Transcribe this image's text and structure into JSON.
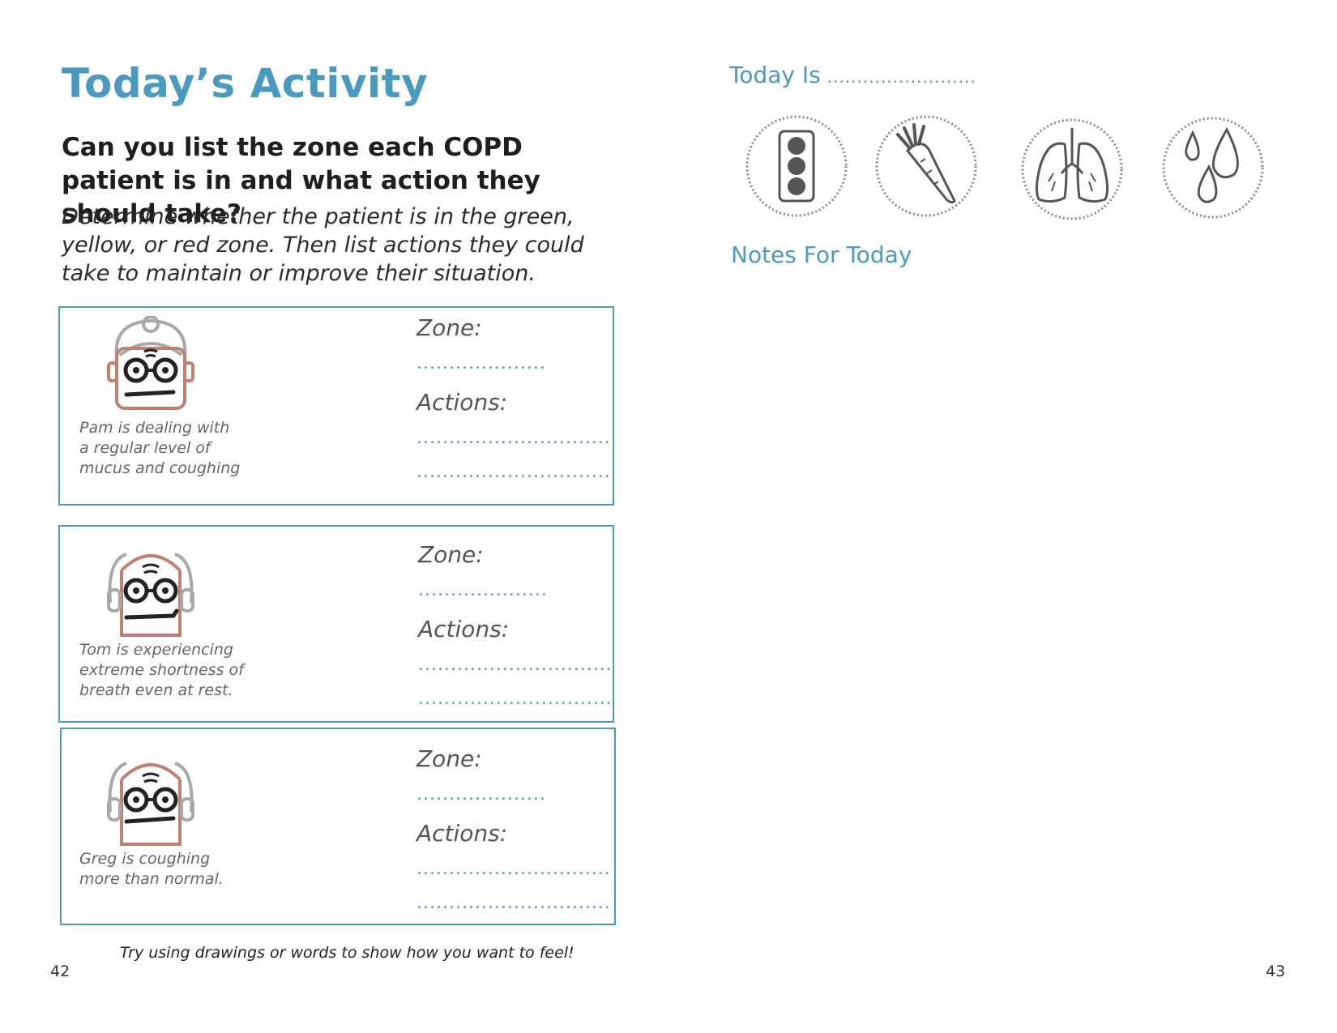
{
  "left_page": {
    "title": "Today’s Activity",
    "question": "Can you list the zone each COPD patient is in and what action they should take?",
    "instructions": "Determine whether the patient is in the green, yellow, or red zone. Then list actions they could take to maintain or improve their situation.",
    "cards": [
      {
        "description_lines": [
          "Pam is dealing with",
          "a regular level of",
          "mucus and coughing"
        ],
        "zone_label": "Zone:",
        "zone_blank": "....................",
        "actions_label": "Actions:",
        "action_blanks": [
          "..............................",
          ".............................."
        ]
      },
      {
        "description_lines": [
          "Tom is experiencing",
          "extreme shortness of",
          "breath even at rest."
        ],
        "zone_label": "Zone:",
        "zone_blank": "....................",
        "actions_label": "Actions:",
        "action_blanks": [
          "..............................",
          ".............................."
        ]
      },
      {
        "description_lines": [
          "Greg is coughing",
          "more than normal."
        ],
        "zone_label": "Zone:",
        "zone_blank": "....................",
        "actions_label": "Actions:",
        "action_blanks": [
          "..............................",
          ".............................."
        ]
      }
    ],
    "footer_tip": "Try using drawings or words to show how you want to feel!",
    "page_number": "42"
  },
  "right_page": {
    "today_label": "Today Is",
    "today_blank": ".........................",
    "icons": [
      "traffic-light-icon",
      "carrot-icon",
      "lungs-icon",
      "water-drops-icon"
    ],
    "notes_label": "Notes For Today",
    "page_number": "43"
  },
  "colors": {
    "accent": "#4a9ac0",
    "face_outline": "#c0806f",
    "hair_gray": "#a8a8a8"
  }
}
